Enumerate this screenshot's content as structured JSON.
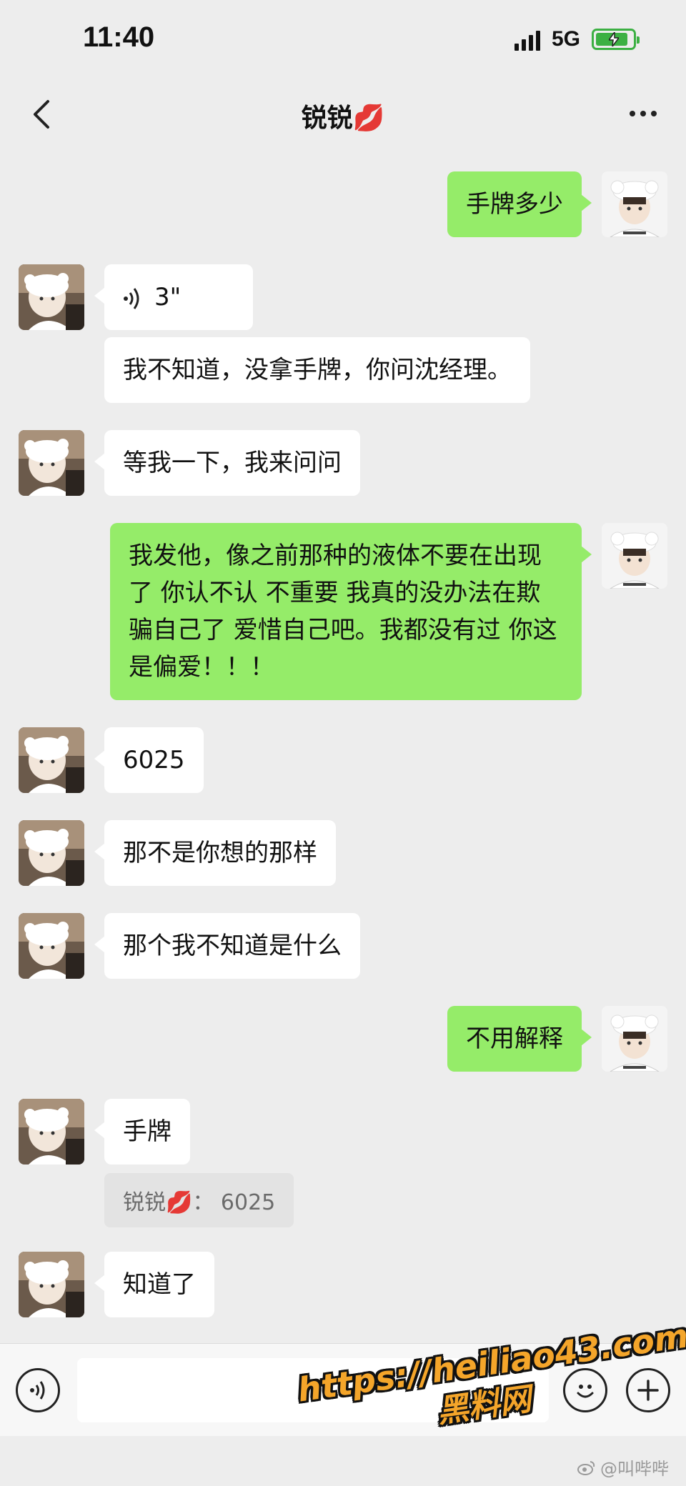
{
  "status_bar": {
    "time": "11:40",
    "network": "5G"
  },
  "nav": {
    "title": "锐锐",
    "title_emoji": "💋"
  },
  "messages": [
    {
      "side": "right",
      "text": "手牌多少"
    },
    {
      "side": "left",
      "type": "voice",
      "text": "3\""
    },
    {
      "side": "left",
      "text": "我不知道，没拿手牌，你问沈经理。"
    },
    {
      "side": "left",
      "text": "等我一下，我来问问"
    },
    {
      "side": "right",
      "text": "我发他，像之前那种的液体不要在出现了 你认不认 不重要 我真的没办法在欺骗自己了 爱惜自己吧。我都没有过 你这是偏爱！！！"
    },
    {
      "side": "left",
      "text": "6025"
    },
    {
      "side": "left",
      "text": "那不是你想的那样"
    },
    {
      "side": "left",
      "text": "那个我不知道是什么"
    },
    {
      "side": "right",
      "text": "不用解释"
    },
    {
      "side": "left",
      "text": "手牌"
    },
    {
      "side": "left",
      "text": "知道了"
    }
  ],
  "quote": {
    "text": "锐锐💋： 6025"
  },
  "watermark": {
    "url": "https://heiliao43.com",
    "name": "黑料网"
  },
  "weibo_mark": "@叫哔哔"
}
